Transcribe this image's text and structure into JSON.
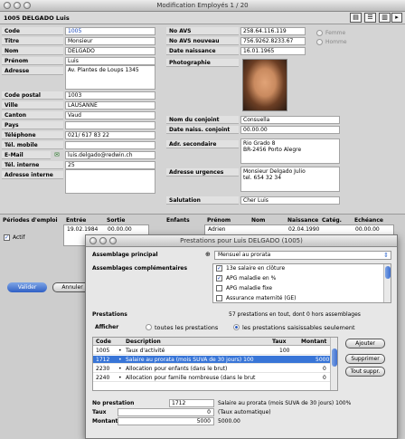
{
  "window": {
    "title": "Modification Employés   1 / 20"
  },
  "header": {
    "employee": "1005 DELGADO Luis"
  },
  "left": {
    "code": {
      "label": "Code",
      "value": "1005"
    },
    "titre": {
      "label": "Titre",
      "value": "Monsieur"
    },
    "nom": {
      "label": "Nom",
      "value": "DELGADO"
    },
    "prenom": {
      "label": "Prénom",
      "value": "Luis"
    },
    "adresse": {
      "label": "Adresse",
      "value": "Av. Plantes de Loups 1345"
    },
    "code_postal": {
      "label": "Code postal",
      "value": "1003"
    },
    "ville": {
      "label": "Ville",
      "value": "LAUSANNE"
    },
    "canton": {
      "label": "Canton",
      "value": "Vaud"
    },
    "pays": {
      "label": "Pays",
      "value": ""
    },
    "telephone": {
      "label": "Téléphone",
      "value": "021/ 617 83 22"
    },
    "tel_mobile": {
      "label": "Tél. mobile",
      "value": ""
    },
    "email": {
      "label": "E-Mail",
      "value": "luis.delgado@redwin.ch"
    },
    "tel_interne": {
      "label": "Tél. interne",
      "value": "25"
    },
    "adresse_interne": {
      "label": "Adresse interne",
      "value": ""
    }
  },
  "right": {
    "no_avs": {
      "label": "No AVS",
      "value": "258.64.116.119"
    },
    "no_avs_nouveau": {
      "label": "No AVS nouveau",
      "value": "756.9262.8233.67"
    },
    "date_naissance": {
      "label": "Date naissance",
      "value": "16.01.1965"
    },
    "photo_label": "Photographie",
    "sexe": {
      "femme": "Femme",
      "homme": "Homme"
    },
    "nom_conjoint": {
      "label": "Nom du conjoint",
      "value": "Consuella"
    },
    "date_naiss_conjoint": {
      "label": "Date naiss. conjoint",
      "value": "00.00.00"
    },
    "adr_secondaire": {
      "label": "Adr. secondaire",
      "line1": "Rio Grado 8",
      "line2": "BR-2456 Porto Alegre"
    },
    "adresse_urgences": {
      "label": "Adresse urgences",
      "line1": "Monsieur Delgado Julio",
      "line2": "tel. 654 32 34"
    },
    "salutation": {
      "label": "Salutation",
      "value": "Cher Luis"
    }
  },
  "periodes": {
    "label": "Périodes d'emploi",
    "cols": [
      "Entrée",
      "Sortie"
    ],
    "row": [
      "19.02.1984",
      "00.00.00"
    ],
    "actif": "Actif"
  },
  "enfants": {
    "label": "Enfants",
    "cols": [
      "Prénom",
      "Nom",
      "Naissance",
      "Catég.",
      "Echéance"
    ],
    "row": [
      "Adrien",
      "",
      "02.04.1990",
      "",
      "00.00.00"
    ]
  },
  "buttons": {
    "valider": "Valider",
    "annuler": "Annuler"
  },
  "modal": {
    "title": "Prestations pour Luis DELGADO  (1005)",
    "assemblage_principal": {
      "label": "Assemblage principal",
      "value": "Mensuel au prorata"
    },
    "assemblages_label": "Assemblages complémentaires",
    "assemblages": [
      {
        "checked": true,
        "label": "13e salaire en clôture"
      },
      {
        "checked": true,
        "label": "APG maladie en %"
      },
      {
        "checked": false,
        "label": "APG maladie fixe"
      },
      {
        "checked": false,
        "label": "Assurance maternité (GE)"
      }
    ],
    "prestations_label": "Prestations",
    "prestations_info": "57 prestations en tout, dont 0 hors assemblages",
    "afficher_label": "Afficher",
    "opt_toutes": "toutes les prestations",
    "opt_saisissables": "les prestations saisissables seulement",
    "cols": [
      "Code",
      "Description",
      "Taux",
      "Montant"
    ],
    "rows": [
      {
        "code": "1005",
        "desc": "Taux d'activité",
        "taux": "100",
        "montant": ""
      },
      {
        "code": "1712",
        "desc": "Salaire au prorata (mois SUVA de 30 jours) 100",
        "taux": "",
        "montant": "5000"
      },
      {
        "code": "2230",
        "desc": "Allocation pour enfants (dans le brut)",
        "taux": "",
        "montant": "0"
      },
      {
        "code": "2240",
        "desc": "Allocation pour famille nombreuse (dans le brut",
        "taux": "",
        "montant": "0"
      }
    ],
    "btn_ajouter": "Ajouter",
    "btn_supprimer": "Supprimer",
    "btn_tout_suppr": "Tout suppr.",
    "no_prestation": {
      "label": "No prestation",
      "value": "1712",
      "desc": "Salaire au prorata (mois SUVA de 30 jours) 100%"
    },
    "taux": {
      "label": "Taux",
      "value": "0",
      "hint": "(Taux automatique)"
    },
    "montant": {
      "label": "Montant",
      "value": "5000",
      "hint": "5000.00"
    }
  }
}
